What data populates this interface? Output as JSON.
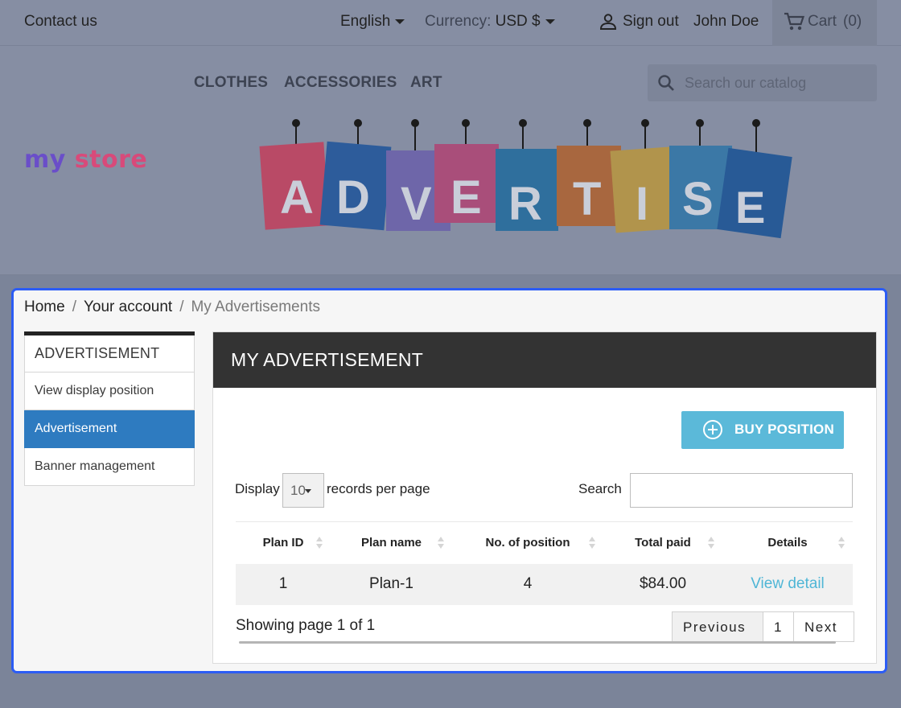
{
  "topbar": {
    "contact": "Contact us",
    "language": "English",
    "currency_label": "Currency:",
    "currency_value": "USD $",
    "signout": "Sign out",
    "user": "John Doe",
    "cart": "Cart",
    "cart_count": "(0)"
  },
  "header": {
    "menu": [
      "CLOTHES",
      "ACCESSORIES",
      "ART"
    ],
    "search_placeholder": "Search our catalog",
    "logo": {
      "w1": "my",
      "w2": "store"
    },
    "banner_letters": [
      "A",
      "D",
      "V",
      "E",
      "R",
      "T",
      "I",
      "S",
      "E"
    ]
  },
  "breadcrumb": {
    "home": "Home",
    "account": "Your account",
    "current": "My Advertisements"
  },
  "sidebar": {
    "title": "ADVERTISEMENT",
    "items": [
      "View display position",
      "Advertisement",
      "Banner management"
    ]
  },
  "panel": {
    "title": "MY ADVERTISEMENT",
    "buy_button": "BUY POSITION",
    "display_label": "Display",
    "display_value": "10",
    "records_label": "records per page",
    "search_label": "Search",
    "columns": [
      "Plan ID",
      "Plan name",
      "No. of position",
      "Total paid",
      "Details"
    ],
    "rows": [
      {
        "plan_id": "1",
        "plan_name": "Plan-1",
        "positions": "4",
        "total_paid": "$84.00",
        "details": "View detail"
      }
    ],
    "showing": "Showing page 1 of 1",
    "pager": {
      "prev": "Previous",
      "page": "1",
      "next": "Next"
    }
  }
}
